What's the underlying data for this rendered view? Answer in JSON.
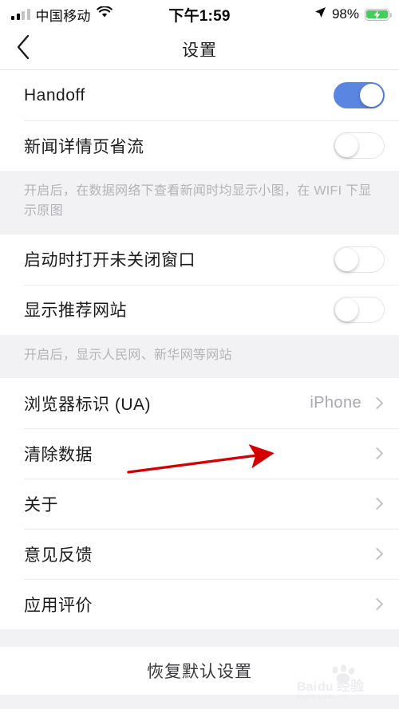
{
  "status_bar": {
    "carrier": "中国移动",
    "wifi_icon": "wifi-icon",
    "signal_icon": "cellular-signal-icon",
    "time": "下午1:59",
    "location_icon": "location-arrow-icon",
    "battery_percent": "98%",
    "battery_icon": "battery-charging-icon"
  },
  "nav": {
    "back_icon": "chevron-left-icon",
    "title": "设置"
  },
  "sections": [
    {
      "rows": [
        {
          "label": "Handoff",
          "control": "toggle",
          "state": "on"
        },
        {
          "label": "新闻详情页省流",
          "control": "toggle",
          "state": "off"
        }
      ],
      "note": "开启后，在数据网络下查看新闻时均显示小图，在 WIFI 下显示原图"
    },
    {
      "rows": [
        {
          "label": "启动时打开未关闭窗口",
          "control": "toggle",
          "state": "off"
        },
        {
          "label": "显示推荐网站",
          "control": "toggle",
          "state": "off"
        }
      ],
      "note": "开启后，显示人民网、新华网等网站"
    },
    {
      "rows": [
        {
          "label": "浏览器标识 (UA)",
          "control": "disclosure",
          "value": "iPhone"
        },
        {
          "label": "清除数据",
          "control": "disclosure",
          "value": ""
        },
        {
          "label": "关于",
          "control": "disclosure",
          "value": ""
        },
        {
          "label": "意见反馈",
          "control": "disclosure",
          "value": ""
        },
        {
          "label": "应用评价",
          "control": "disclosure",
          "value": ""
        }
      ],
      "note": ""
    }
  ],
  "bottom_action": {
    "label": "恢复默认设置"
  },
  "annotation": {
    "arrow_color": "#d40000",
    "points_to": "清除数据"
  },
  "watermark": {
    "brand": "Baidu",
    "suffix": "经验",
    "url": "jingyan.baidu.com"
  },
  "colors": {
    "toggle_on": "#5a85e0",
    "background": "#f2f2f4",
    "row_background": "#ffffff",
    "note_text": "#b4b4b8",
    "battery_green": "#41cf5a"
  }
}
